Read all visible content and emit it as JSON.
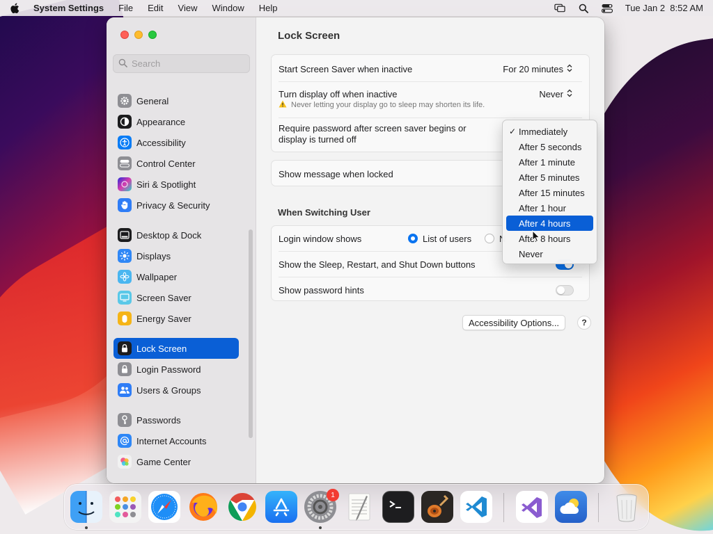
{
  "menubar": {
    "app_name": "System Settings",
    "items": [
      "File",
      "Edit",
      "View",
      "Window",
      "Help"
    ],
    "clock": "Tue Jan 2  8:52 AM"
  },
  "sidebar": {
    "search_placeholder": "Search",
    "items": [
      {
        "label": "General",
        "icon": "gear-icon",
        "color": "#8e8e93"
      },
      {
        "label": "Appearance",
        "icon": "appearance-icon",
        "color": "#1c1c1e"
      },
      {
        "label": "Accessibility",
        "icon": "accessibility-icon",
        "color": "#0a7cf5"
      },
      {
        "label": "Control Center",
        "icon": "control-center-icon",
        "color": "#8e8e93"
      },
      {
        "label": "Siri & Spotlight",
        "icon": "siri-icon",
        "color": "#7a3cd8"
      },
      {
        "label": "Privacy & Security",
        "icon": "hand-icon",
        "color": "#2f7df6"
      },
      {
        "label": "Desktop & Dock",
        "icon": "dock-icon",
        "color": "#1c1c1e"
      },
      {
        "label": "Displays",
        "icon": "sun-icon",
        "color": "#2f87f6"
      },
      {
        "label": "Wallpaper",
        "icon": "flower-icon",
        "color": "#4ab6f0"
      },
      {
        "label": "Screen Saver",
        "icon": "screen-saver-icon",
        "color": "#5ac8e8"
      },
      {
        "label": "Energy Saver",
        "icon": "battery-icon",
        "color": "#f5b417"
      },
      {
        "label": "Lock Screen",
        "icon": "lock-icon",
        "color": "#1c1c1e"
      },
      {
        "label": "Login Password",
        "icon": "lock-icon",
        "color": "#8e8e93"
      },
      {
        "label": "Users & Groups",
        "icon": "users-icon",
        "color": "#2f7df6"
      },
      {
        "label": "Passwords",
        "icon": "key-icon",
        "color": "#8e8e93"
      },
      {
        "label": "Internet Accounts",
        "icon": "at-icon",
        "color": "#2f87f6"
      },
      {
        "label": "Game Center",
        "icon": "game-center-icon",
        "color": "#f25c8b"
      }
    ],
    "selected": "Lock Screen"
  },
  "content": {
    "title": "Lock Screen",
    "screen_saver_label": "Start Screen Saver when inactive",
    "screen_saver_value": "For 20 minutes",
    "display_off_label": "Turn display off when inactive",
    "display_off_value": "Never",
    "display_off_warning": "Never letting your display go to sleep may shorten its life.",
    "require_password_label_1": "Require password after screen saver begins or",
    "require_password_label_2": "display is turned off",
    "show_message_label": "Show message when locked",
    "switching_title": "When Switching User",
    "login_window_label": "Login window shows",
    "login_option_1": "List of users",
    "login_option_2": "N",
    "sleep_buttons_label": "Show the Sleep, Restart, and Shut Down buttons",
    "password_hints_label": "Show password hints",
    "accessibility_button": "Accessibility Options...",
    "help_button": "?"
  },
  "dropdown": {
    "options": [
      "Immediately",
      "After 5 seconds",
      "After 1 minute",
      "After 5 minutes",
      "After 15 minutes",
      "After 1 hour",
      "After 4 hours",
      "After 8 hours",
      "Never"
    ],
    "checked": "Immediately",
    "highlighted": "After 4 hours"
  },
  "dock": {
    "settings_badge": "1",
    "apps": [
      "finder-icon",
      "launchpad-icon",
      "safari-icon",
      "firefox-icon",
      "chrome-icon",
      "app-store-icon",
      "system-settings-icon",
      "textedit-icon",
      "terminal-icon",
      "garageband-icon",
      "vscode-icon",
      "visual-studio-icon",
      "weather-icon",
      "trash-icon"
    ]
  },
  "colors": {
    "accent": "#0a5fd6",
    "toggle_on": "#0a74f0"
  }
}
